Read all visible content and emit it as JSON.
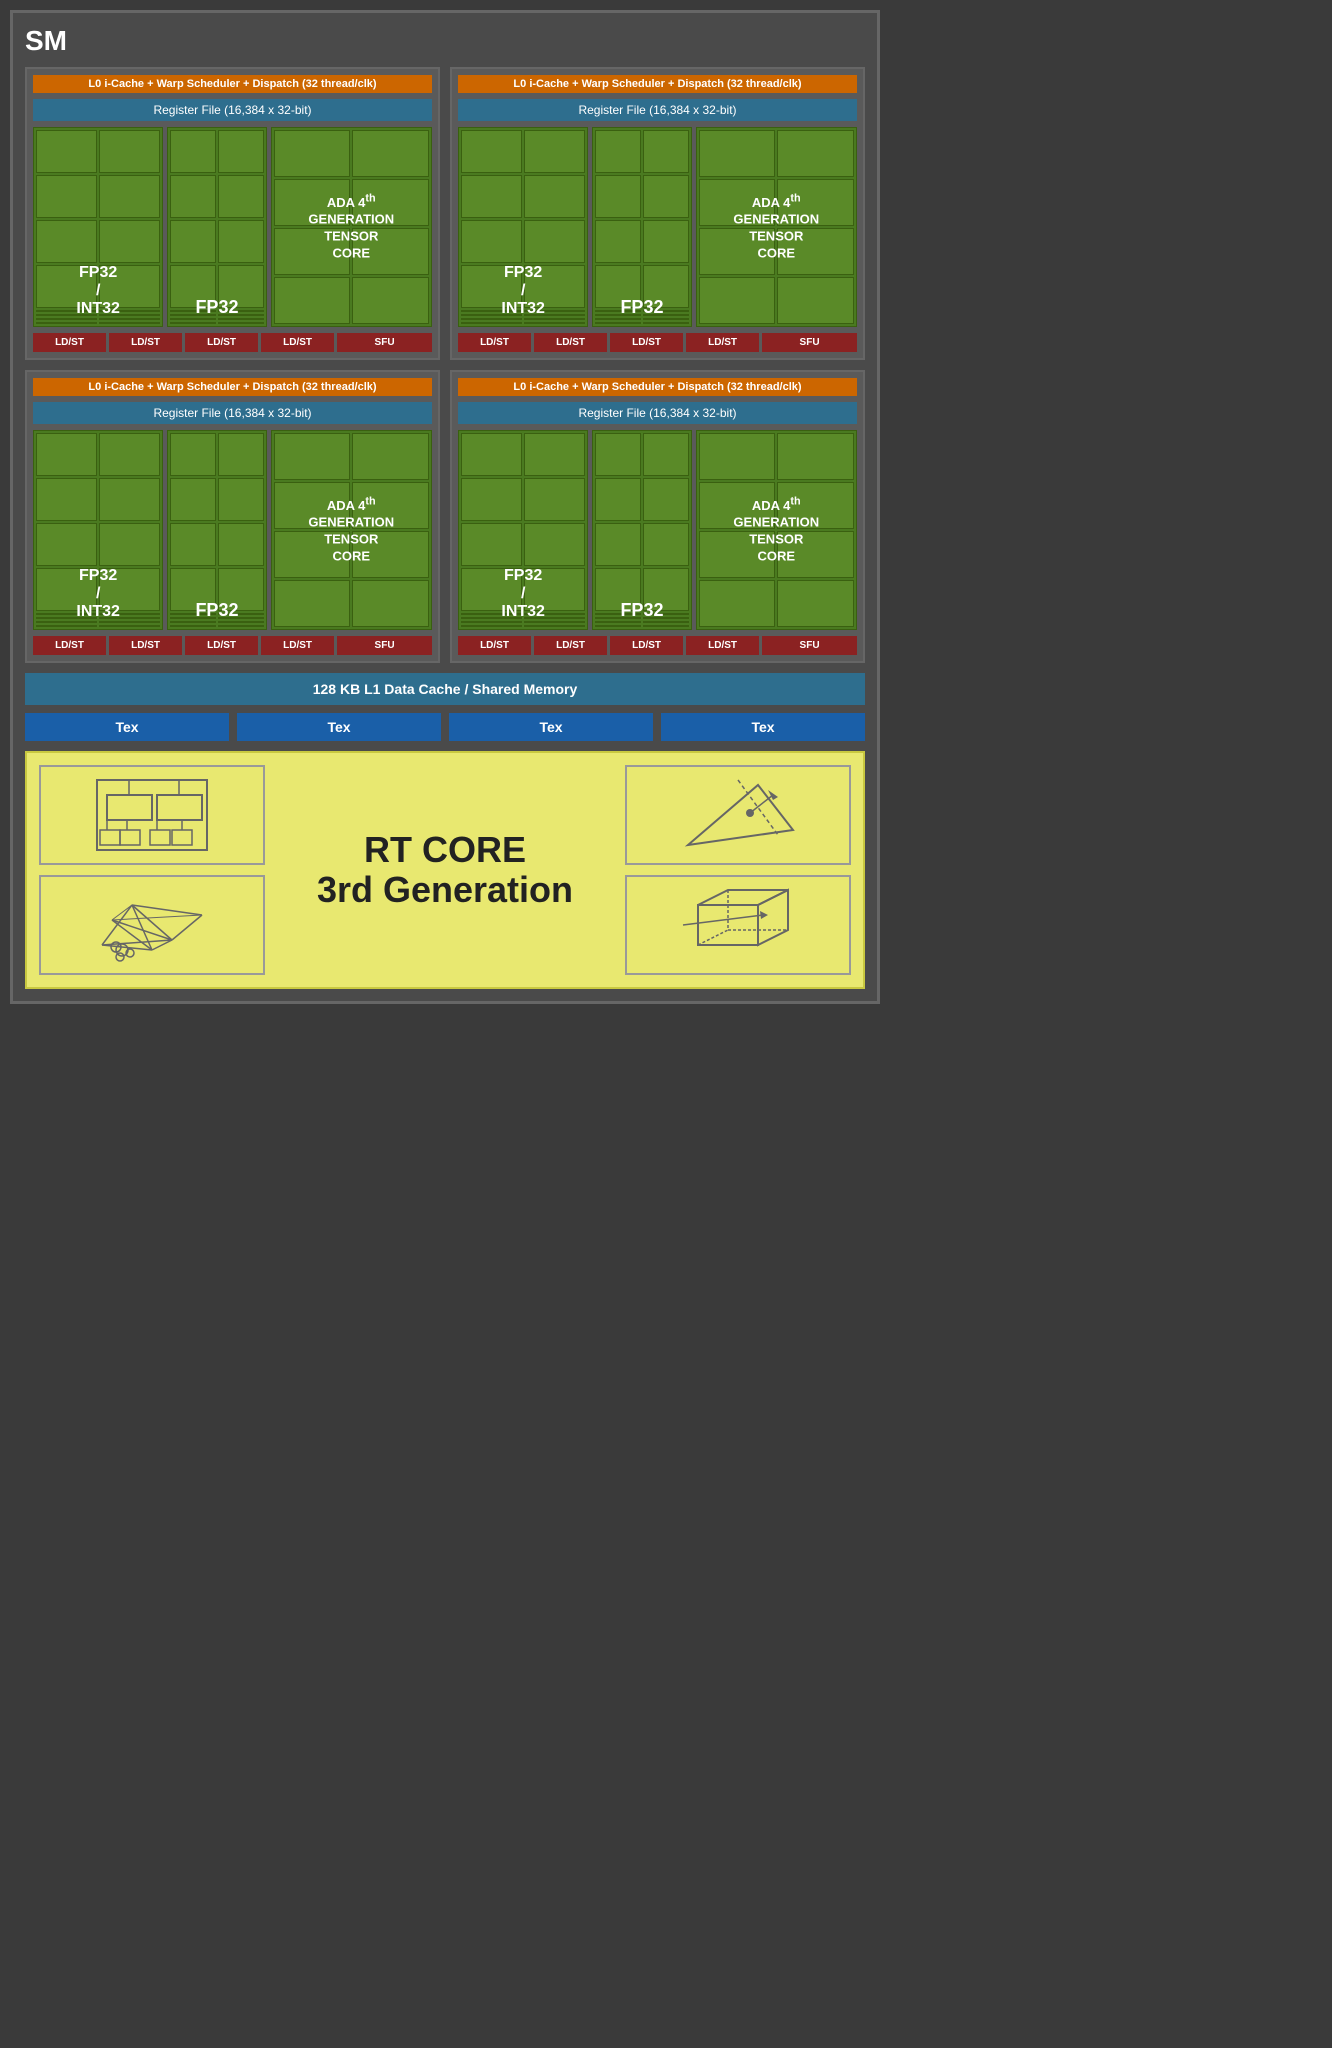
{
  "sm_title": "SM",
  "warp_scheduler": "L0 i-Cache + Warp Scheduler + Dispatch (32 thread/clk)",
  "register_file": "Register File (16,384 x 32-bit)",
  "fp32_int32_label": "FP32\n/\nINT32",
  "fp32_label": "FP32",
  "tensor_label": "ADA 4th\nGENERATION\nTENSOR CORE",
  "ld_st_labels": [
    "LD/ST",
    "LD/ST",
    "LD/ST",
    "LD/ST"
  ],
  "sfu_label": "SFU",
  "l1_cache": "128 KB L1 Data Cache / Shared Memory",
  "tex_labels": [
    "Tex",
    "Tex",
    "Tex",
    "Tex"
  ],
  "rt_core_line1": "RT CORE",
  "rt_core_line2": "3rd Generation"
}
